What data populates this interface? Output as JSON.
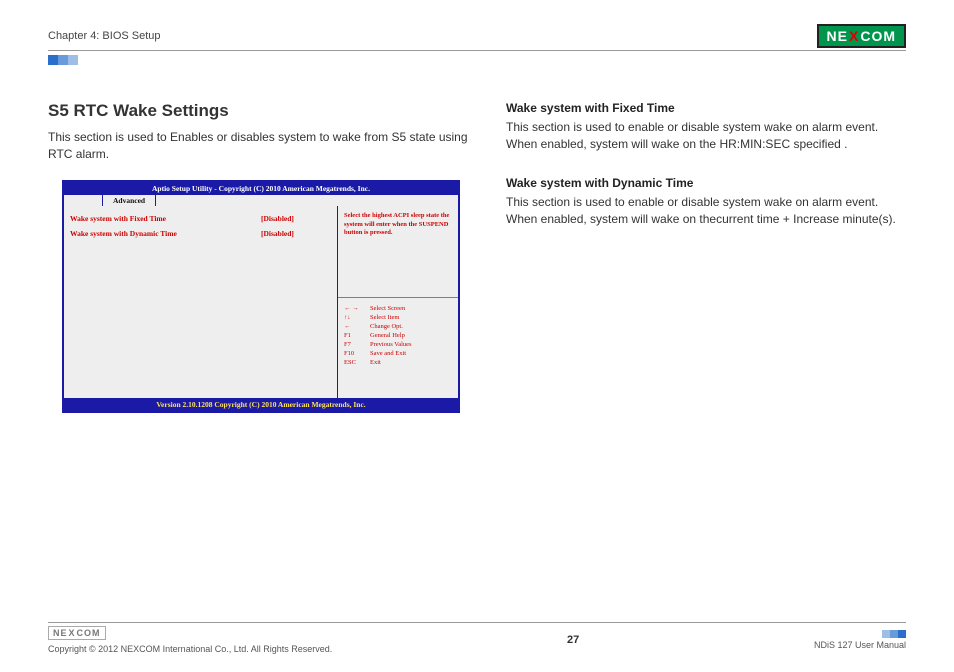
{
  "header": {
    "chapter": "Chapter 4: BIOS Setup",
    "logo_pre": "NE",
    "logo_x": "X",
    "logo_post": "COM"
  },
  "left": {
    "title": "S5 RTC Wake Settings",
    "intro": "This section is used to Enables or disables system to wake from S5 state using RTC alarm."
  },
  "bios": {
    "top": "Aptio Setup Utility - Copyright (C) 2010 American Megatrends, Inc.",
    "tab": "Advanced",
    "rows": [
      {
        "label": "Wake system with Fixed Time",
        "value": "[Disabled]"
      },
      {
        "label": "Wake system with Dynamic Time",
        "value": "[Disabled]"
      }
    ],
    "help": "Select the highest ACPI sleep state the system will enter when the SUSPEND button is pressed.",
    "keys": [
      {
        "k": "← →",
        "d": "Select Screen"
      },
      {
        "k": "↑↓",
        "d": "Select Item"
      },
      {
        "k": "←",
        "d": "Change Opt."
      },
      {
        "k": "F1",
        "d": "General Help"
      },
      {
        "k": "F7",
        "d": "Previous Values"
      },
      {
        "k": "F10",
        "d": "Save and Exit"
      },
      {
        "k": "ESC",
        "d": "Exit"
      }
    ],
    "bottom": "Version 2.10.1208 Copyright (C) 2010 American Megatrends, Inc."
  },
  "right": {
    "s1_head": "Wake system with Fixed Time",
    "s1_body": "This section is used to enable or disable system wake on alarm event. When enabled, system will wake on the HR:MIN:SEC specified .",
    "s2_head": "Wake system with Dynamic Time",
    "s2_body": "This section is used to enable or disable system wake on alarm event. When enabled, system will wake on thecurrent time + Increase minute(s)."
  },
  "footer": {
    "copyright": "Copyright © 2012 NEXCOM International Co., Ltd. All Rights Reserved.",
    "page": "27",
    "manual": "NDiS 127 User Manual"
  }
}
